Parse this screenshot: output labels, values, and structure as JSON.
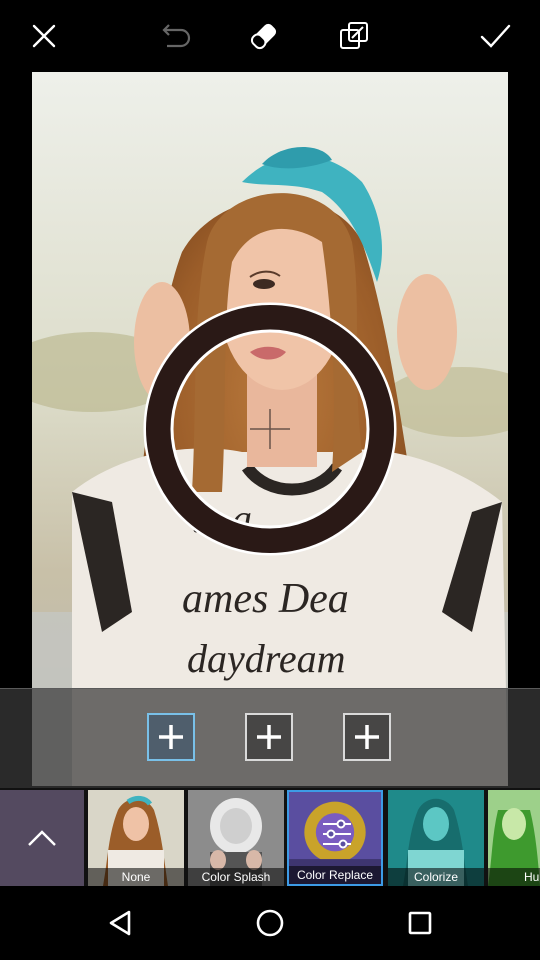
{
  "toolbar": {
    "close": "close-icon",
    "undo": "undo-icon",
    "eraser": "eraser-icon",
    "compare": "compare-icon",
    "apply": "check-icon"
  },
  "photo": {
    "shirt_lines": [
      "... a",
      "ames Dea",
      "daydream"
    ]
  },
  "color_slots": [
    {
      "icon": "plus-icon",
      "selected": true
    },
    {
      "icon": "plus-icon",
      "selected": false
    },
    {
      "icon": "plus-icon",
      "selected": false
    }
  ],
  "effects": {
    "expand_icon": "chevron-up-icon",
    "items": [
      {
        "label": "None"
      },
      {
        "label": "Color Splash"
      },
      {
        "label": "Color Replace",
        "selected": true
      },
      {
        "label": "Colorize"
      },
      {
        "label": "Hu"
      }
    ]
  },
  "navbar": {
    "back": "back-triangle-icon",
    "home": "home-circle-icon",
    "recents": "recents-square-icon"
  },
  "colors": {
    "accent": "#3d9be6",
    "active_slot": "#79c0e8",
    "brush_ring": "#2a1916"
  }
}
